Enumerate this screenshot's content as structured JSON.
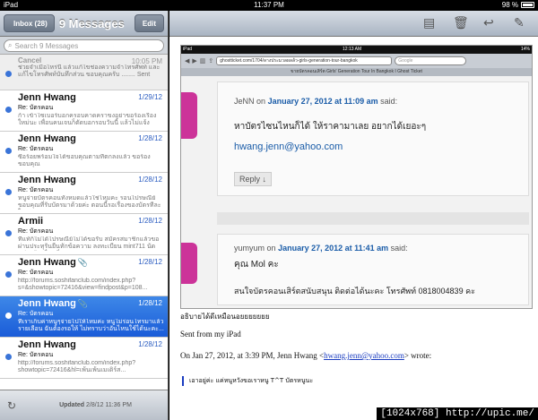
{
  "status": {
    "device": "iPad",
    "time": "11:37 PM",
    "battery": "98 %"
  },
  "mailbox": {
    "back_label": "Inbox (28)",
    "title": "9 Messages",
    "edit_label": "Edit",
    "search_placeholder": "Search 9 Messages",
    "messages": [
      {
        "from": "Cancel",
        "date": "10:05 PM",
        "subject": "",
        "preview": "ช่วยจำเมื่อไหร่นี้ แล้วแก้ไขช่องความจำโทรศัพท์ และแก้ไขโทรศัพท์บันทึกส่วน ขอบคุณครับ ........ Sent from my iPhon..."
      },
      {
        "from": "Jenn Hwang",
        "date": "1/29/12",
        "subject": "Re: บัตรคอน",
        "preview": "ก้า เข้าไซเบอร์บอกครอบคาดคราขงอย่าขอร้องเรื่องใหม่นะ เพื่อนคนเจนก็ตัดบอกรอบวันนี้ แล้วไม่แจ้งการ..."
      },
      {
        "from": "Jenn Hwang",
        "date": "1/28/12",
        "subject": "Re: บัตรคอน",
        "preview": "ซื้อร้อยพร้อมใจได้ขอบคุณตามที่ตกลงแล้ว ขอร้อง ขอบคุณ"
      },
      {
        "from": "Jenn Hwang",
        "date": "1/28/12",
        "subject": "Re: บัตรคอน",
        "preview": "หนูจ่ายบัตรคอนทั้งหมดแล้วใช่ไหมคะ รอนไปรษณีย์ขอบคุณที่รับบัตรมาด้วยค่ะ ตอนนี้รอเรื่องของบัตรทีละใบ..."
      },
      {
        "from": "Armii",
        "date": "1/28/12",
        "subject": "Re: บัตรคอน",
        "preview": "ที่แท้ก็ไม่ได้ไปรษณีย์ไม่ได้ขอรับ สมัครสมาชิกแล้วขอผ่านประทุรันยืนทักข้อความ ลงทะเบียน mint711 นัดแต่ละวันเพื่อนที่ ..."
      },
      {
        "from": "Jenn Hwang",
        "date": "1/28/12",
        "subject": "Re: บัตรคอน",
        "preview": "http://forums.soshifanclub.com/index.php?s=&showtopic=72416&view=findpost&p=108..."
      },
      {
        "from": "Jenn Hwang",
        "date": "1/28/12",
        "subject": "Re: บัตรคอน",
        "preview": "ที่เราเก็บค่าหนูๆจ่ายไปให้ไหมค่ะ หนูไม่ร่อนโทรมาแล้วรายเลือน ฉันต้องรอให้ ไม่ทราบว่าอันไหนใช้ได้นะคะ..."
      },
      {
        "from": "Jenn Hwang",
        "date": "1/28/12",
        "subject": "Re: บัตรคอน",
        "preview": "http://forums.soshifanclub.com/index.php?showtopic=72416&hl=เพ้นเพ้นเมเดิร์ส..."
      }
    ],
    "updated_label": "Updated",
    "updated_date": "2/8/12",
    "updated_time": "11:36 PM"
  },
  "embedded": {
    "device": "iPad",
    "time": "12:13 AM",
    "battery": "14%",
    "url": "ghostticket.com/1704/ลางประมวลผลล้ว-girls-generation-tour-bangkok",
    "search": "Google",
    "page_title": "ขายบัตรคอนเสิร์ต Girls' Generation Tour In Bangkok I Ghost Ticket",
    "comments": [
      {
        "author": "JeNN",
        "on": "on",
        "date": "January 27, 2012 at 11:09 am",
        "said": "said:",
        "text": "หาบัตรไซนไหนก็ได้ ให้ราคามาเลย อยากได้เยอะๆ",
        "email": "hwang.jenn@yahoo.com",
        "reply": "Reply ↓"
      },
      {
        "author": "yumyum",
        "on": "on",
        "date": "January 27, 2012 at 11:41 am",
        "said": "said:",
        "text": "คุณ Mol คะ",
        "extra": "สนใจบัตรคอนเสิร์ตสนับสนุน ติดต่อได้นะคะ โทรศัพท์ 0818004839 คะ"
      }
    ]
  },
  "mail": {
    "thai_line": "อธิบายได้ดีเหมือนอยยยยยยย",
    "signature": "Sent from my iPad",
    "wrote_prefix": "On Jan 27, 2012, at 3:39 PM, Jenn Hwang <",
    "wrote_email": "hwang.jenn@yahoo.com",
    "wrote_suffix": "> wrote:",
    "quote_line": "เอาอยู่ค่ะ แค่หนูหวังขอเราหนู T^T บัตรหนูนะ"
  },
  "watermark": "[1024x768] http://upic.me/"
}
